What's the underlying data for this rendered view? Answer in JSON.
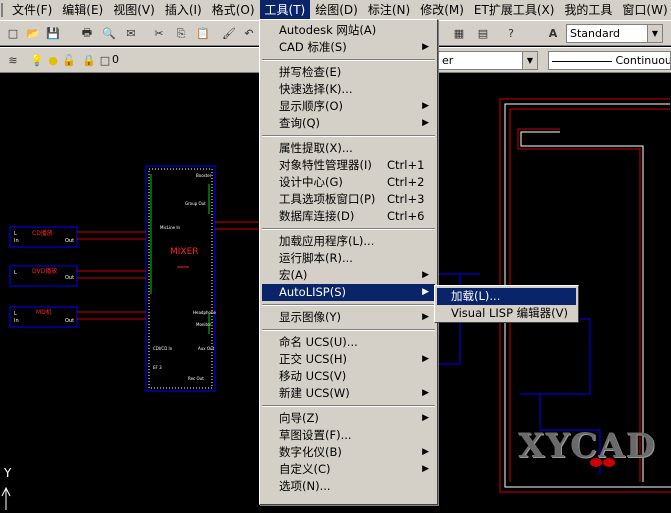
{
  "menubar": [
    {
      "label": "文件(F)"
    },
    {
      "label": "编辑(E)"
    },
    {
      "label": "视图(V)"
    },
    {
      "label": "插入(I)"
    },
    {
      "label": "格式(O)"
    },
    {
      "label": "工具(T)",
      "open": true
    },
    {
      "label": "绘图(D)"
    },
    {
      "label": "标注(N)"
    },
    {
      "label": "修改(M)"
    },
    {
      "label": "ET扩展工具(X)"
    },
    {
      "label": "我的工具"
    },
    {
      "label": "窗口(W)"
    }
  ],
  "toolbar": {
    "text_style": "Standard",
    "layer_value": "0",
    "color_combo": "er",
    "linetype": "Continuous"
  },
  "tools_menu": {
    "items": [
      {
        "label": "Autodesk 网站(A)"
      },
      {
        "label": "CAD 标准(S)",
        "submenu": true
      },
      {
        "sep": true
      },
      {
        "label": "拼写检查(E)"
      },
      {
        "label": "快速选择(K)..."
      },
      {
        "label": "显示顺序(O)",
        "submenu": true
      },
      {
        "label": "查询(Q)",
        "submenu": true
      },
      {
        "sep": true
      },
      {
        "label": "属性提取(X)..."
      },
      {
        "label": "对象特性管理器(I)",
        "shortcut": "Ctrl+1"
      },
      {
        "label": "设计中心(G)",
        "shortcut": "Ctrl+2"
      },
      {
        "label": "工具选项板窗口(P)",
        "shortcut": "Ctrl+3"
      },
      {
        "label": "数据库连接(D)",
        "shortcut": "Ctrl+6"
      },
      {
        "sep": true
      },
      {
        "label": "加载应用程序(L)..."
      },
      {
        "label": "运行脚本(R)..."
      },
      {
        "label": "宏(A)",
        "submenu": true
      },
      {
        "label": "AutoLISP(S)",
        "submenu": true,
        "highlighted": true
      },
      {
        "sep": true
      },
      {
        "label": "显示图像(Y)",
        "submenu": true
      },
      {
        "sep": true
      },
      {
        "label": "命名 UCS(U)..."
      },
      {
        "label": "正交 UCS(H)",
        "submenu": true
      },
      {
        "label": "移动 UCS(V)"
      },
      {
        "label": "新建 UCS(W)",
        "submenu": true
      },
      {
        "sep": true
      },
      {
        "label": "向导(Z)",
        "submenu": true
      },
      {
        "label": "草图设置(F)..."
      },
      {
        "label": "数字化仪(B)",
        "submenu": true
      },
      {
        "label": "自定义(C)",
        "submenu": true
      },
      {
        "label": "选项(N)..."
      }
    ]
  },
  "autolisp_submenu": {
    "items": [
      {
        "label": "加载(L)...",
        "highlighted": true
      },
      {
        "label": "Visual LISP 编辑器(V)"
      }
    ]
  },
  "drawing": {
    "mixer_label": "MIXER",
    "sources": [
      "CD播放",
      "DVD播放",
      "MD机"
    ],
    "ucs_label": "Y"
  },
  "watermark": "XYCAD"
}
